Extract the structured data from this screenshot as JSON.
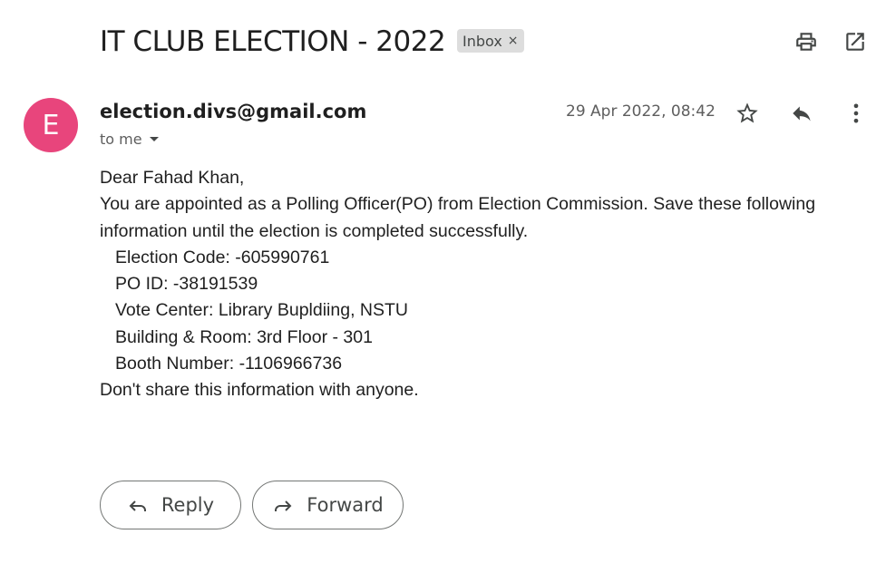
{
  "email": {
    "subject": "IT CLUB ELECTION - 2022",
    "label": "Inbox",
    "label_remove": "×",
    "sender_initial": "E",
    "sender": "election.divs@gmail.com",
    "recipient": "to me",
    "date": "29 Apr 2022, 08:42",
    "body": {
      "greeting": "Dear Fahad Khan,",
      "intro_line1": "You are appointed as a Polling Officer(PO) from Election Commission. Save these following",
      "intro_line2": "information until the election is completed successfully.",
      "details": [
        "Election Code: -605990761",
        "PO ID: -38191539",
        "Vote Center: Library Bupldiing, NSTU",
        "Building & Room: 3rd Floor - 301",
        "Booth Number: -1106966736"
      ],
      "closing": "Don't share this information with anyone."
    }
  },
  "actions": {
    "reply_label": "Reply",
    "forward_label": "Forward"
  },
  "colors": {
    "avatar": "#e8457c",
    "label_chip": "#dddddd",
    "text": "#1f1f1f",
    "muted": "#5e5e5e"
  },
  "icons": [
    "print-icon",
    "open-new-window-icon",
    "star-icon",
    "reply-icon",
    "more-vert-icon",
    "caret-down-icon",
    "forward-icon"
  ]
}
